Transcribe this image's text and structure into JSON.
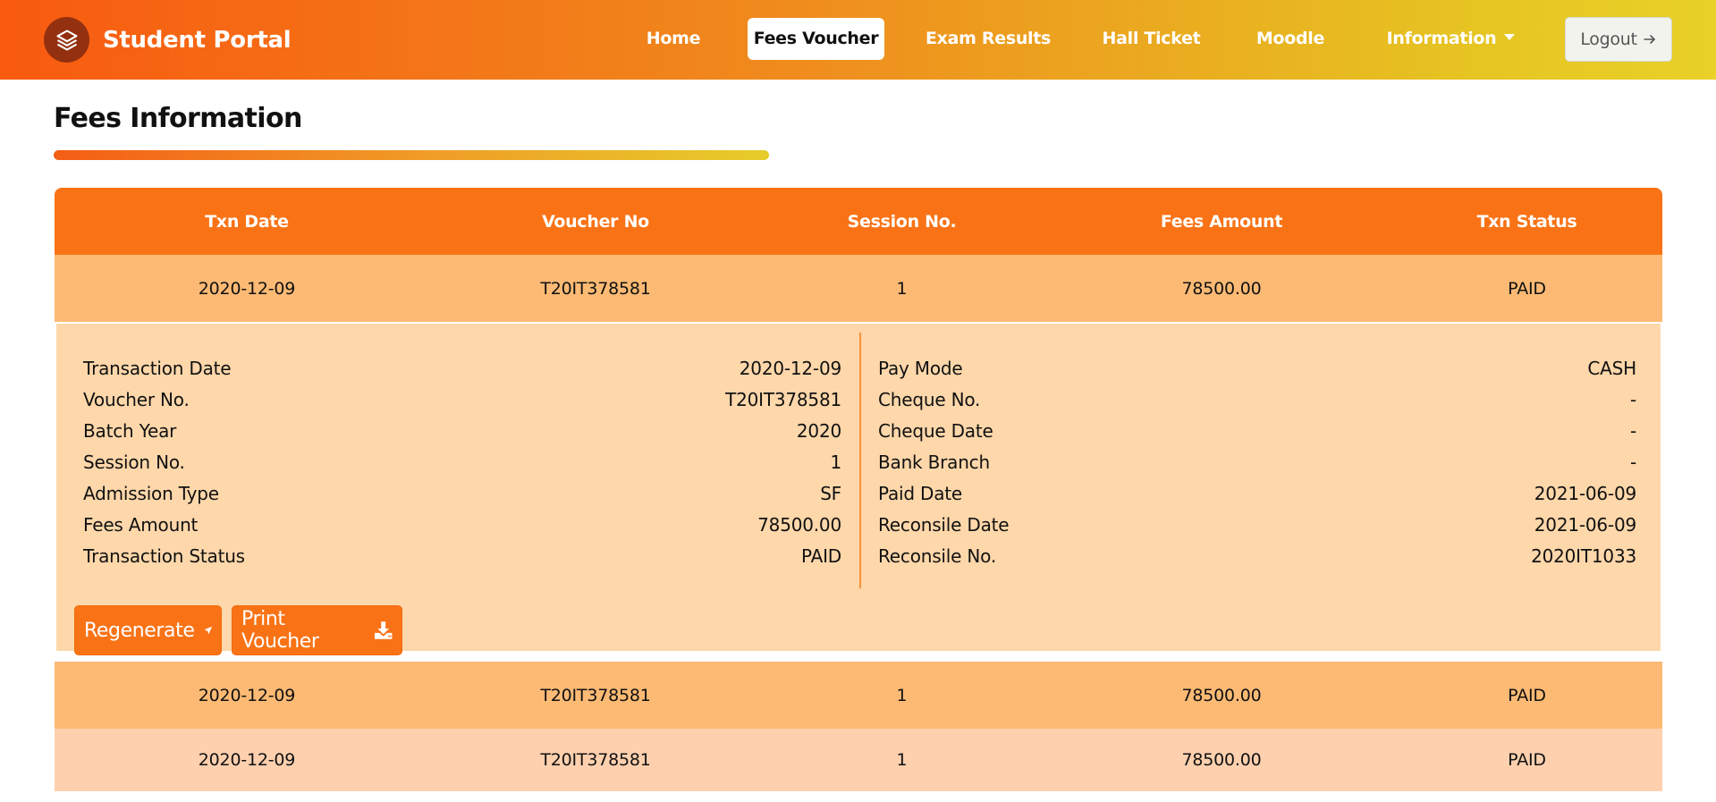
{
  "brand": {
    "title": "Student Portal",
    "icon": "layers-icon"
  },
  "nav": {
    "items": [
      {
        "label": "Home",
        "active": false
      },
      {
        "label": "Fees Voucher",
        "active": true
      },
      {
        "label": "Exam Results",
        "active": false
      },
      {
        "label": "Hall Ticket",
        "active": false
      },
      {
        "label": "Moodle",
        "active": false
      },
      {
        "label": "Information",
        "active": false,
        "dropdown": true
      }
    ],
    "logout_label": "Logout"
  },
  "page": {
    "title": "Fees Information"
  },
  "table": {
    "headers": [
      "Txn Date",
      "Voucher No",
      "Session No.",
      "Fees Amount",
      "Txn Status"
    ],
    "rows": [
      [
        "2020-12-09",
        "T20IT378581",
        "1",
        "78500.00",
        "PAID"
      ],
      [
        "2020-12-09",
        "T20IT378581",
        "1",
        "78500.00",
        "PAID"
      ],
      [
        "2020-12-09",
        "T20IT378581",
        "1",
        "78500.00",
        "PAID"
      ]
    ]
  },
  "detail": {
    "left": [
      {
        "label": "Transaction Date",
        "value": "2020-12-09"
      },
      {
        "label": "Voucher No.",
        "value": "T20IT378581"
      },
      {
        "label": "Batch Year",
        "value": "2020"
      },
      {
        "label": "Session No.",
        "value": "1"
      },
      {
        "label": "Admission Type",
        "value": "SF"
      },
      {
        "label": "Fees Amount",
        "value": "78500.00"
      },
      {
        "label": "Transaction Status",
        "value": "PAID"
      }
    ],
    "right": [
      {
        "label": "Pay Mode",
        "value": "CASH"
      },
      {
        "label": "Cheque No.",
        "value": "-"
      },
      {
        "label": "Cheque Date",
        "value": "-"
      },
      {
        "label": "Bank Branch",
        "value": "-"
      },
      {
        "label": "Paid Date",
        "value": "2021-06-09"
      },
      {
        "label": "Reconsile Date",
        "value": "2021-06-09"
      },
      {
        "label": "Reconsile No.",
        "value": "2020IT1033"
      }
    ],
    "regenerate_label": "Regenerate",
    "print_label": "Print Voucher"
  },
  "colors": {
    "header_orange": "#f97316",
    "row_main": "#fdba74",
    "row_detail": "#fed7aa",
    "row_light": "#fed0ae"
  }
}
